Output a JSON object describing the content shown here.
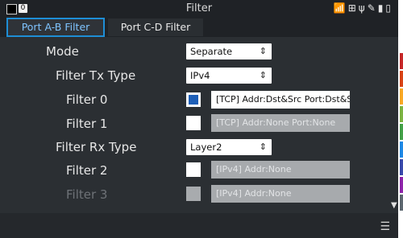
{
  "window": {
    "title": "Filter",
    "badge": "0"
  },
  "status_icons": [
    "wifi-icon",
    "network-icon",
    "usb-icon",
    "pen-icon",
    "sd-card-icon",
    "battery-icon"
  ],
  "tabs": [
    {
      "label": "Port A-B Filter",
      "active": true
    },
    {
      "label": "Port C-D Filter",
      "active": false
    }
  ],
  "rows": {
    "mode": {
      "label": "Mode",
      "value": "Separate"
    },
    "tx_type": {
      "label": "Filter Tx Type",
      "value": "IPv4"
    },
    "filter0": {
      "label": "Filter 0",
      "checked": true,
      "value": "[TCP]  Addr:Dst&Src  Port:Dst&Src"
    },
    "filter1": {
      "label": "Filter 1",
      "checked": false,
      "value": "[TCP]  Addr:None  Port:None"
    },
    "rx_type": {
      "label": "Filter Rx Type",
      "value": "Layer2"
    },
    "filter2": {
      "label": "Filter 2",
      "checked": false,
      "value": "[IPv4]  Addr:None"
    },
    "filter3": {
      "label": "Filter 3",
      "checked": false,
      "disabled": true,
      "value": "[IPv4]  Addr:None"
    }
  },
  "chevron_glyph": "⌃⌄",
  "side_stripe_colors": [
    "#c62828",
    "#d84315",
    "#f9a825",
    "#7cb342",
    "#43a047",
    "#1e88e5",
    "#3949ab",
    "#8e24aa",
    "#5d6770"
  ],
  "accent_color": "#1e8ed6"
}
